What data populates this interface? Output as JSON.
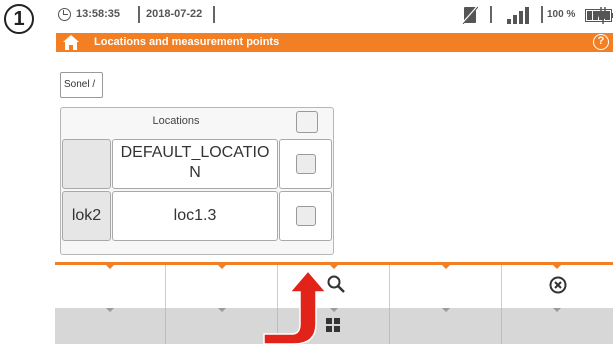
{
  "step_marker": "1",
  "status_bar": {
    "time": "13:58:35",
    "date": "2018-07-22",
    "battery_percent": "100 %"
  },
  "title_bar": {
    "title": "Locations and measurement points",
    "help_symbol": "?"
  },
  "breadcrumb": "Sonel /",
  "table": {
    "header": "Locations",
    "rows": [
      {
        "prefix": "",
        "name": "DEFAULT_LOCATIO N",
        "checked": false
      },
      {
        "prefix": "lok2",
        "name": "loc1.3",
        "checked": false
      }
    ]
  },
  "colors": {
    "accent": "#f27f24",
    "arrow": "#e2231a"
  },
  "toolbar": {
    "buttons": [
      "blank",
      "blank",
      "search-icon",
      "blank",
      "close-circle-icon"
    ],
    "bottom_buttons": [
      "blank",
      "blank",
      "grid-icon",
      "blank",
      "blank"
    ]
  }
}
